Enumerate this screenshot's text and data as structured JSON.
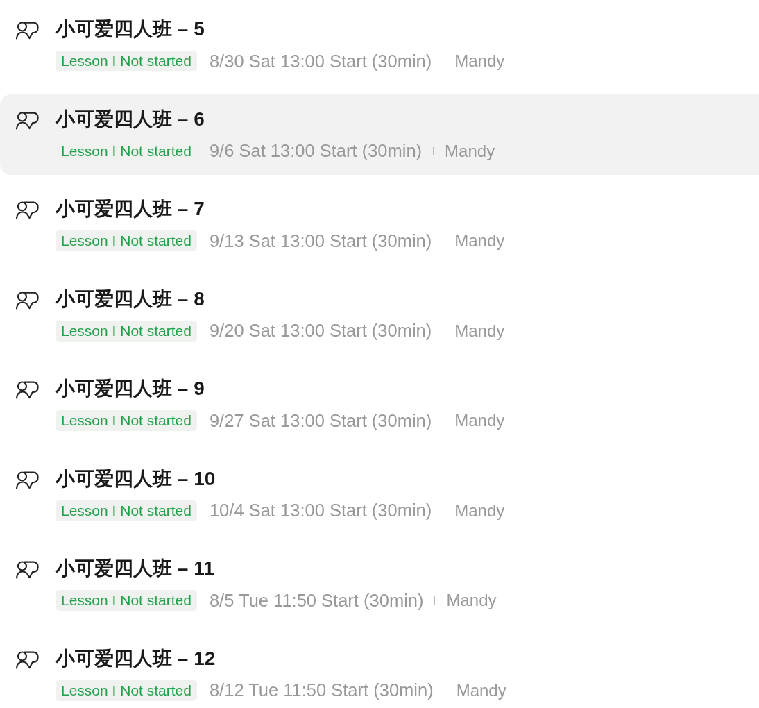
{
  "lessons": [
    {
      "title": "小可爱四人班 – 5",
      "status": "Lesson I Not started",
      "schedule": "8/30 Sat 13:00 Start (30min)",
      "teacher": "Mandy",
      "selected": false
    },
    {
      "title": "小可爱四人班 – 6",
      "status": "Lesson I Not started",
      "schedule": "9/6 Sat 13:00 Start (30min)",
      "teacher": "Mandy",
      "selected": true
    },
    {
      "title": "小可爱四人班 – 7",
      "status": "Lesson I Not started",
      "schedule": "9/13 Sat 13:00 Start (30min)",
      "teacher": "Mandy",
      "selected": false
    },
    {
      "title": "小可爱四人班 – 8",
      "status": "Lesson I Not started",
      "schedule": "9/20 Sat 13:00 Start (30min)",
      "teacher": "Mandy",
      "selected": false
    },
    {
      "title": "小可爱四人班 – 9",
      "status": "Lesson I Not started",
      "schedule": "9/27 Sat 13:00 Start (30min)",
      "teacher": "Mandy",
      "selected": false
    },
    {
      "title": "小可爱四人班 – 10",
      "status": "Lesson I Not started",
      "schedule": "10/4 Sat 13:00 Start (30min)",
      "teacher": "Mandy",
      "selected": false
    },
    {
      "title": "小可爱四人班 – 11",
      "status": "Lesson I Not started",
      "schedule": "8/5 Tue 11:50 Start (30min)",
      "teacher": "Mandy",
      "selected": false
    },
    {
      "title": "小可爱四人班 – 12",
      "status": "Lesson I Not started",
      "schedule": "8/12 Tue 11:50 Start (30min)",
      "teacher": "Mandy",
      "selected": false
    }
  ]
}
